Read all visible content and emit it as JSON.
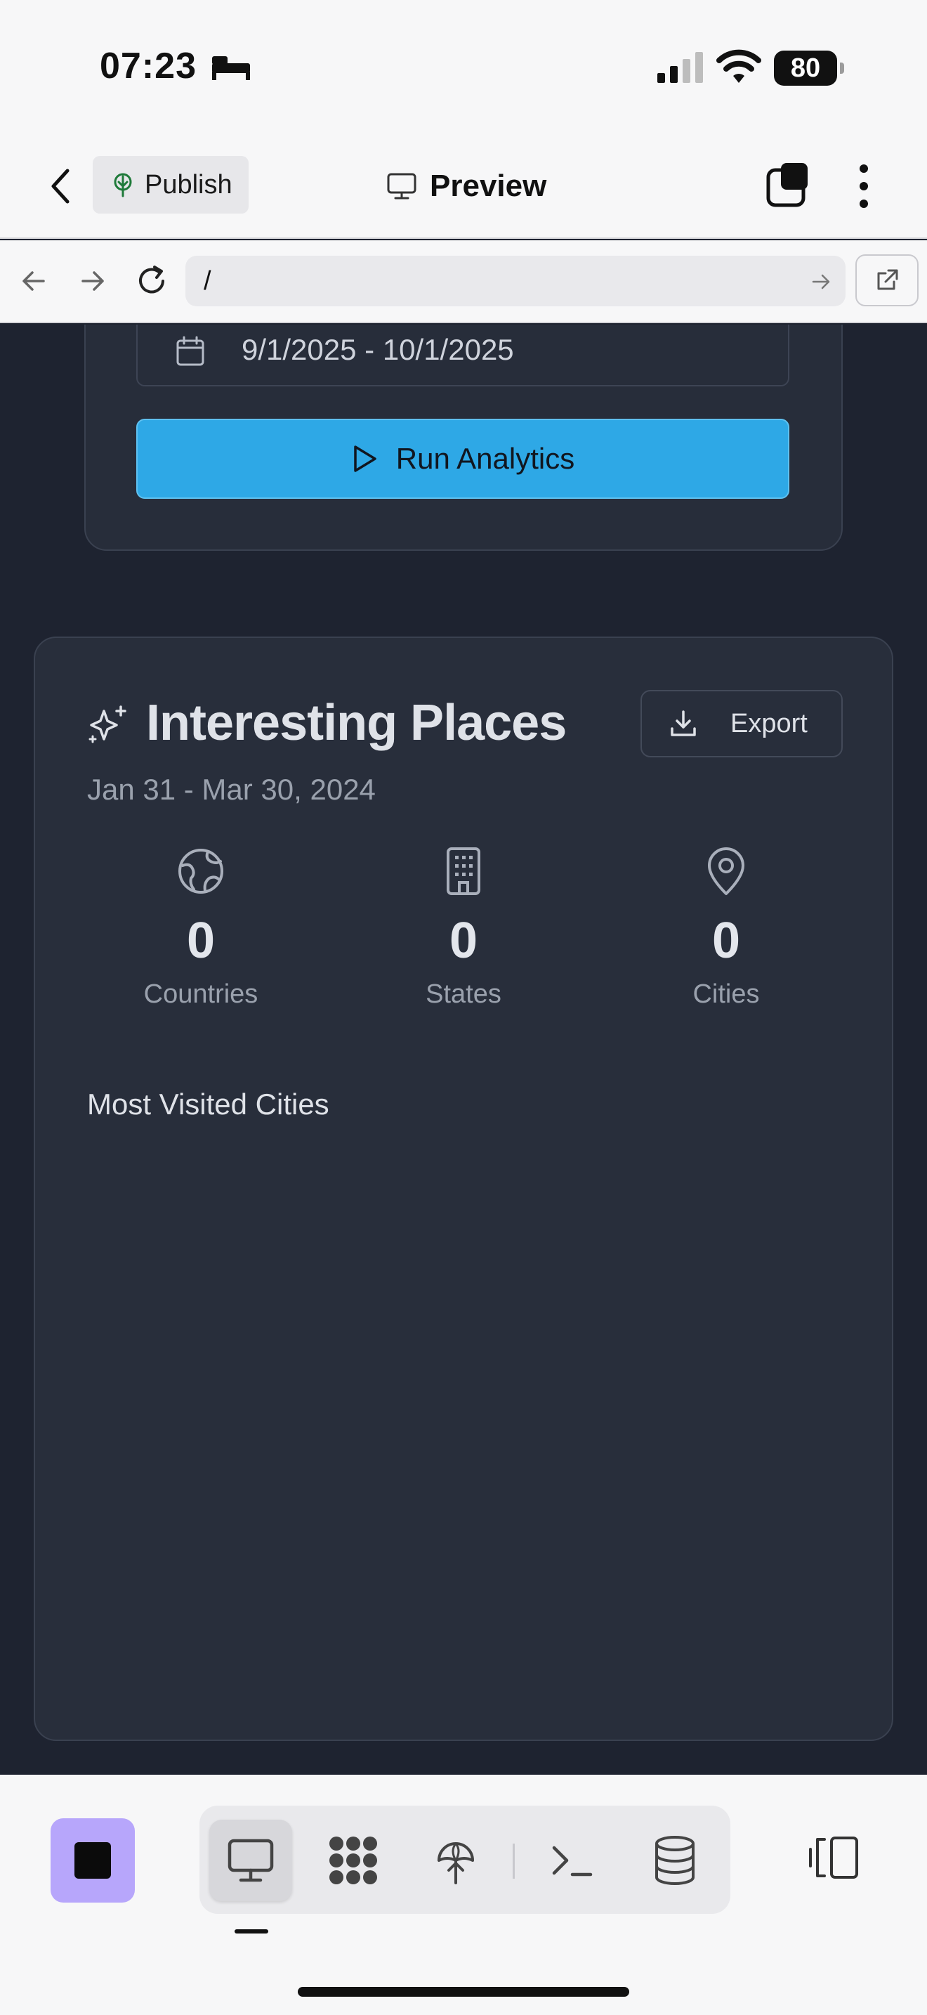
{
  "status_bar": {
    "time": "07:23",
    "battery": "80",
    "icons": [
      "sleep-icon",
      "cellular-signal-icon",
      "wifi-icon",
      "battery-icon"
    ]
  },
  "header": {
    "back_icon": "chevron-left-icon",
    "publish_label": "Publish",
    "publish_icon": "publish-tree-icon",
    "preview_label": "Preview",
    "preview_icon": "monitor-icon",
    "tabs_icon": "tabs-icon",
    "more_icon": "more-vertical-icon"
  },
  "browser": {
    "url": "/",
    "icons": [
      "arrow-left-icon",
      "arrow-right-icon",
      "reload-icon",
      "go-arrow-icon",
      "open-external-icon"
    ]
  },
  "filter": {
    "date_range": "9/1/2025 - 10/1/2025",
    "run_label": "Run Analytics"
  },
  "places": {
    "title": "Interesting Places",
    "export_label": "Export",
    "date_range": "Jan 31 - Mar 30, 2024",
    "stats": [
      {
        "icon": "globe-icon",
        "value": "0",
        "label": "Countries"
      },
      {
        "icon": "building-icon",
        "value": "0",
        "label": "States"
      },
      {
        "icon": "map-pin-icon",
        "value": "0",
        "label": "Cities"
      }
    ],
    "most_visited_label": "Most Visited Cities"
  },
  "bottom_toolbar": {
    "tools": [
      "monitor-icon",
      "apps-icon",
      "publish-icon",
      "terminal-icon",
      "database-icon"
    ],
    "active_tool": "monitor-icon"
  },
  "colors": {
    "accent": "#2ea8e6",
    "stop_button": "#b7a6fb",
    "background_dark": "#1e2330",
    "card": "#282e3b"
  }
}
